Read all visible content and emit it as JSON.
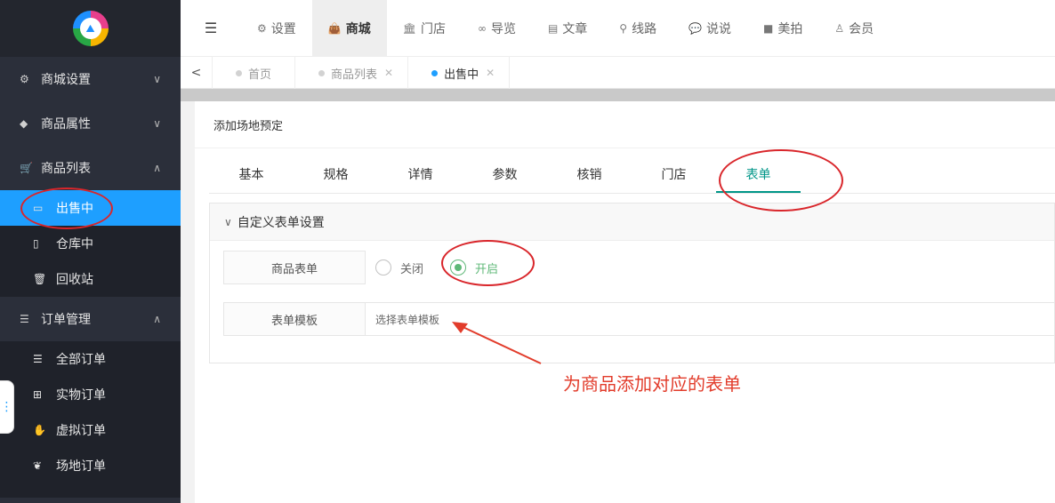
{
  "sidebar": {
    "groups": [
      {
        "label": "商城设置",
        "icon": "gears-icon",
        "chevron": "∨"
      },
      {
        "label": "商品属性",
        "icon": "cube-icon",
        "chevron": "∨"
      },
      {
        "label": "商品列表",
        "icon": "cart-icon",
        "chevron": "∧"
      }
    ],
    "product_items": [
      {
        "label": "出售中",
        "icon": "battery-full-icon",
        "active": true
      },
      {
        "label": "仓库中",
        "icon": "battery-empty-icon"
      },
      {
        "label": "回收站",
        "icon": "trash-icon"
      }
    ],
    "order_group": {
      "label": "订单管理",
      "icon": "list-icon",
      "chevron": "∧"
    },
    "order_items": [
      {
        "label": "全部订单",
        "icon": "list-icon"
      },
      {
        "label": "实物订单",
        "icon": "grid-icon"
      },
      {
        "label": "虚拟订单",
        "icon": "hand-icon"
      },
      {
        "label": "场地订单",
        "icon": "leaf-icon"
      }
    ]
  },
  "topnav": {
    "items": [
      {
        "label": "设置",
        "icon": "gears-icon"
      },
      {
        "label": "商城",
        "icon": "bag-icon",
        "active": true
      },
      {
        "label": "门店",
        "icon": "bank-icon"
      },
      {
        "label": "导览",
        "icon": "binoculars-icon"
      },
      {
        "label": "文章",
        "icon": "newspaper-icon"
      },
      {
        "label": "线路",
        "icon": "route-icon"
      },
      {
        "label": "说说",
        "icon": "wechat-icon"
      },
      {
        "label": "美拍",
        "icon": "video-icon"
      },
      {
        "label": "会员",
        "icon": "user-icon"
      }
    ]
  },
  "tabs": {
    "items": [
      {
        "label": "首页",
        "closable": false
      },
      {
        "label": "商品列表",
        "closable": true
      },
      {
        "label": "出售中",
        "closable": true,
        "active": true
      }
    ]
  },
  "panel": {
    "title": "添加场地预定",
    "form_tabs": [
      "基本",
      "规格",
      "详情",
      "参数",
      "核销",
      "门店",
      "表单"
    ],
    "active_tab": "表单",
    "section_title": "自定义表单设置",
    "product_form_label": "商品表单",
    "radio_off": "关闭",
    "radio_on": "开启",
    "template_label": "表单模板",
    "template_placeholder": "选择表单模板"
  },
  "annotation": {
    "text": "为商品添加对应的表单",
    "color": "#e23c2b"
  },
  "colors": {
    "sidebar_bg": "#2b2f3a",
    "active_blue": "#1e9fff",
    "tab_green": "#009688",
    "radio_green": "#5fb878",
    "annotation_red": "#d9262b"
  }
}
